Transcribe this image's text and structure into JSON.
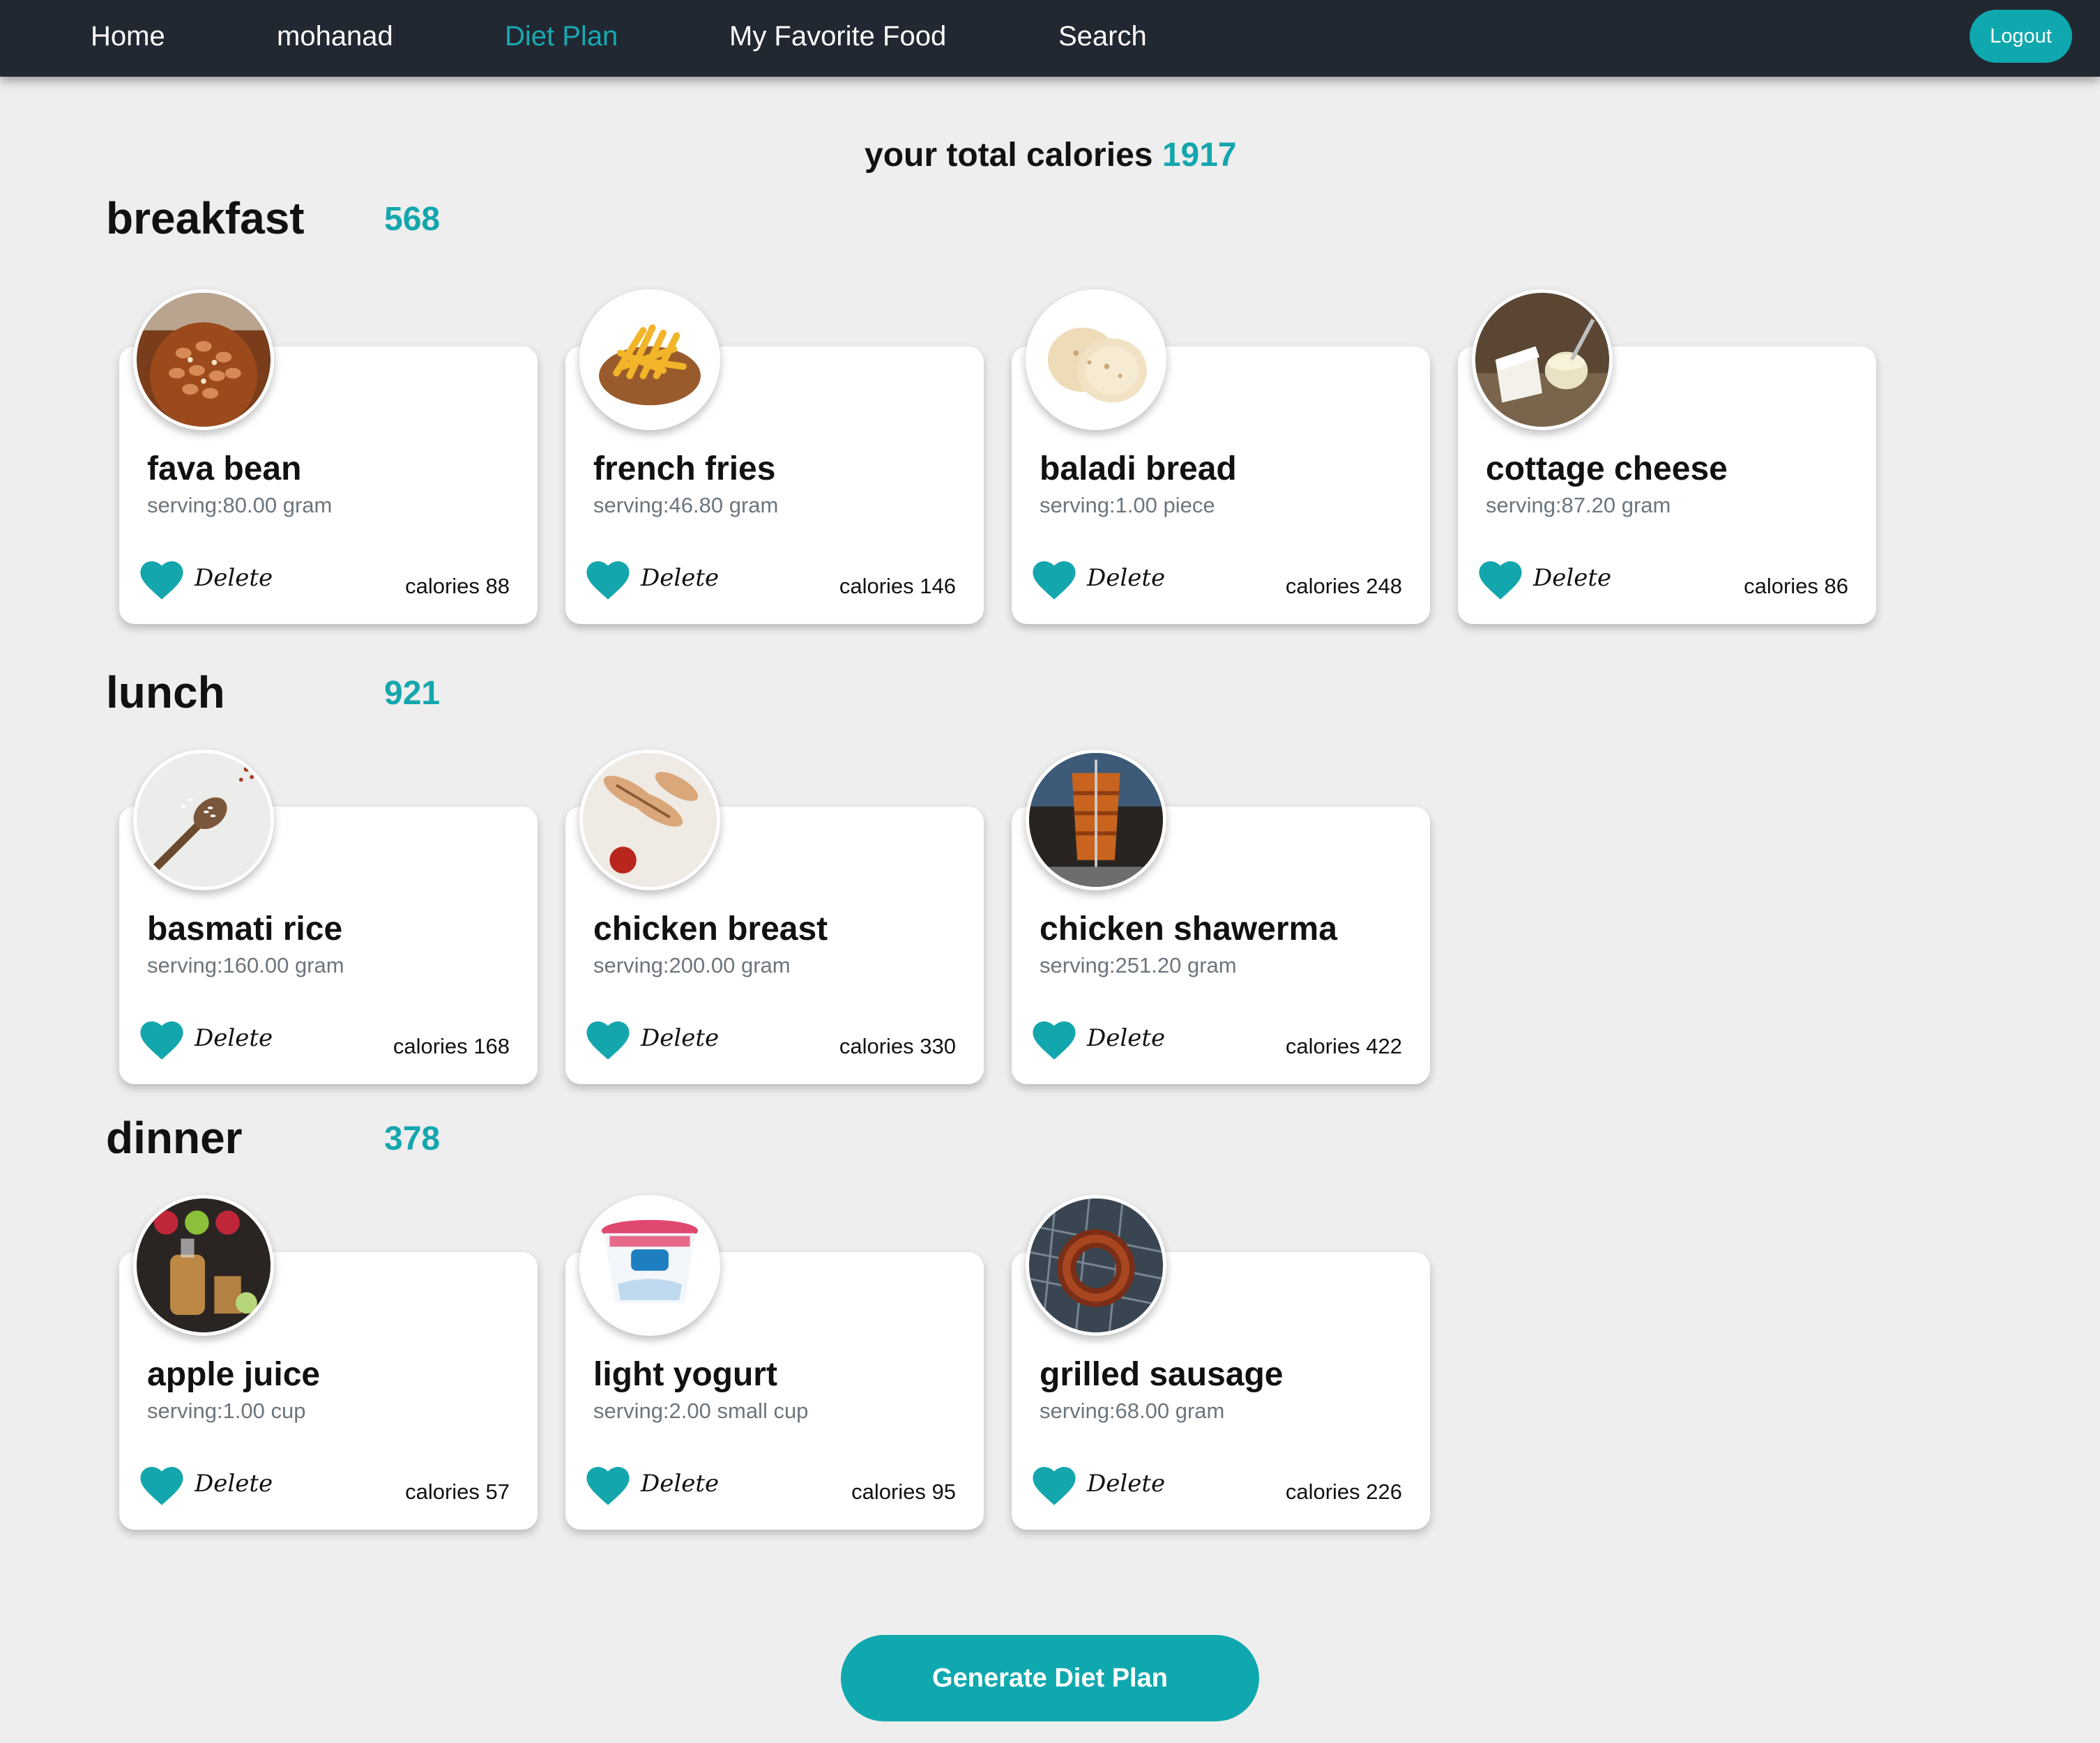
{
  "nav": {
    "home": "Home",
    "user": "mohanad",
    "diet_plan": "Diet Plan",
    "favorites": "My Favorite Food",
    "search": "Search",
    "logout": "Logout"
  },
  "total": {
    "label": "your total calories",
    "value": "1917"
  },
  "meals": [
    {
      "name": "breakfast",
      "calories": "568",
      "foods": [
        {
          "name": "fava bean",
          "serving": "serving:80.00 gram",
          "calories": "calories 88",
          "delete": "Delete",
          "image_icon": "fava-bean-photo"
        },
        {
          "name": "french fries",
          "serving": "serving:46.80 gram",
          "calories": "calories 146",
          "delete": "Delete",
          "image_icon": "french-fries-photo"
        },
        {
          "name": "baladi bread",
          "serving": "serving:1.00 piece",
          "calories": "calories 248",
          "delete": "Delete",
          "image_icon": "baladi-bread-photo"
        },
        {
          "name": "cottage cheese",
          "serving": "serving:87.20 gram",
          "calories": "calories 86",
          "delete": "Delete",
          "image_icon": "cottage-cheese-photo"
        }
      ]
    },
    {
      "name": "lunch",
      "calories": "921",
      "foods": [
        {
          "name": "basmati rice",
          "serving": "serving:160.00 gram",
          "calories": "calories 168",
          "delete": "Delete",
          "image_icon": "basmati-rice-photo"
        },
        {
          "name": "chicken breast",
          "serving": "serving:200.00 gram",
          "calories": "calories 330",
          "delete": "Delete",
          "image_icon": "chicken-breast-photo"
        },
        {
          "name": "chicken shawerma",
          "serving": "serving:251.20 gram",
          "calories": "calories 422",
          "delete": "Delete",
          "image_icon": "chicken-shawerma-photo"
        }
      ]
    },
    {
      "name": "dinner",
      "calories": "378",
      "foods": [
        {
          "name": "apple juice",
          "serving": "serving:1.00 cup",
          "calories": "calories 57",
          "delete": "Delete",
          "image_icon": "apple-juice-photo"
        },
        {
          "name": "light yogurt",
          "serving": "serving:2.00 small cup",
          "calories": "calories 95",
          "delete": "Delete",
          "image_icon": "light-yogurt-photo"
        },
        {
          "name": "grilled sausage",
          "serving": "serving:68.00 gram",
          "calories": "calories 226",
          "delete": "Delete",
          "image_icon": "grilled-sausage-photo"
        }
      ]
    }
  ],
  "generate_button": "Generate Diet Plan",
  "colors": {
    "accent": "#0fa8ae",
    "navbar": "#212832",
    "background": "#eeeeee",
    "heart": "#14a6ad"
  },
  "icons": {
    "favorite": "heart-icon"
  }
}
